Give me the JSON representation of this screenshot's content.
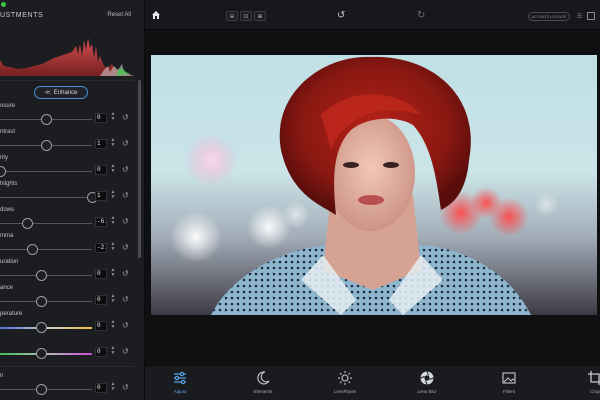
{
  "panel": {
    "title": "USTMENTS",
    "reset_label": "Reset All",
    "enhance_label": "Enhance",
    "adjustments": [
      {
        "id": "exposure",
        "label": "osure",
        "value": "0",
        "level": 0.5
      },
      {
        "id": "contrast",
        "label": "ntrast",
        "value": "1",
        "level": 0.5
      },
      {
        "id": "clarity",
        "label": "rity",
        "value": "0",
        "level": 0.0
      },
      {
        "id": "highlights",
        "label": "hlights",
        "value": "1",
        "level": 1.0
      },
      {
        "id": "shadows",
        "label": "dows",
        "value": "-6...",
        "level": 0.3
      },
      {
        "id": "gamma",
        "label": "mma",
        "value": "-2...",
        "level": 0.35
      },
      {
        "id": "saturation",
        "label": "uration",
        "value": "0",
        "level": 0.45
      },
      {
        "id": "vibrance",
        "label": "ance",
        "value": "0",
        "level": 0.45
      },
      {
        "id": "temperature",
        "label": "perature",
        "value": "0",
        "level": 0.45
      },
      {
        "id": "tint",
        "label": "",
        "value": "0",
        "level": 0.45
      },
      {
        "id": "last",
        "label": "n",
        "value": "0",
        "level": 0.45
      }
    ]
  },
  "toolbar": {
    "zoom_out_icon": "zoom-out-icon",
    "zoom_fit_icon": "zoom-fit-icon",
    "zoom_in_icon": "zoom-in-icon",
    "activate_label": "ACTIVATE LICENSE"
  },
  "tools": [
    {
      "id": "adjust",
      "label": "Adjust",
      "icon": "sliders-icon",
      "active": true
    },
    {
      "id": "elements",
      "label": "Elements",
      "icon": "moon-icon",
      "active": false
    },
    {
      "id": "lensflares",
      "label": "LensFlares",
      "icon": "sun-icon",
      "active": false
    },
    {
      "id": "lensblur",
      "label": "Lens Blur",
      "icon": "aperture-icon",
      "active": false
    },
    {
      "id": "filters",
      "label": "Filters",
      "icon": "image-icon",
      "active": false
    },
    {
      "id": "crop",
      "label": "Crop",
      "icon": "crop-icon",
      "active": false
    }
  ],
  "colors": {
    "accent": "#4a8fd8",
    "active_tool": "#5aa7ef",
    "panel_bg": "#1c1d20",
    "canvas_bg": "#0f1012"
  }
}
